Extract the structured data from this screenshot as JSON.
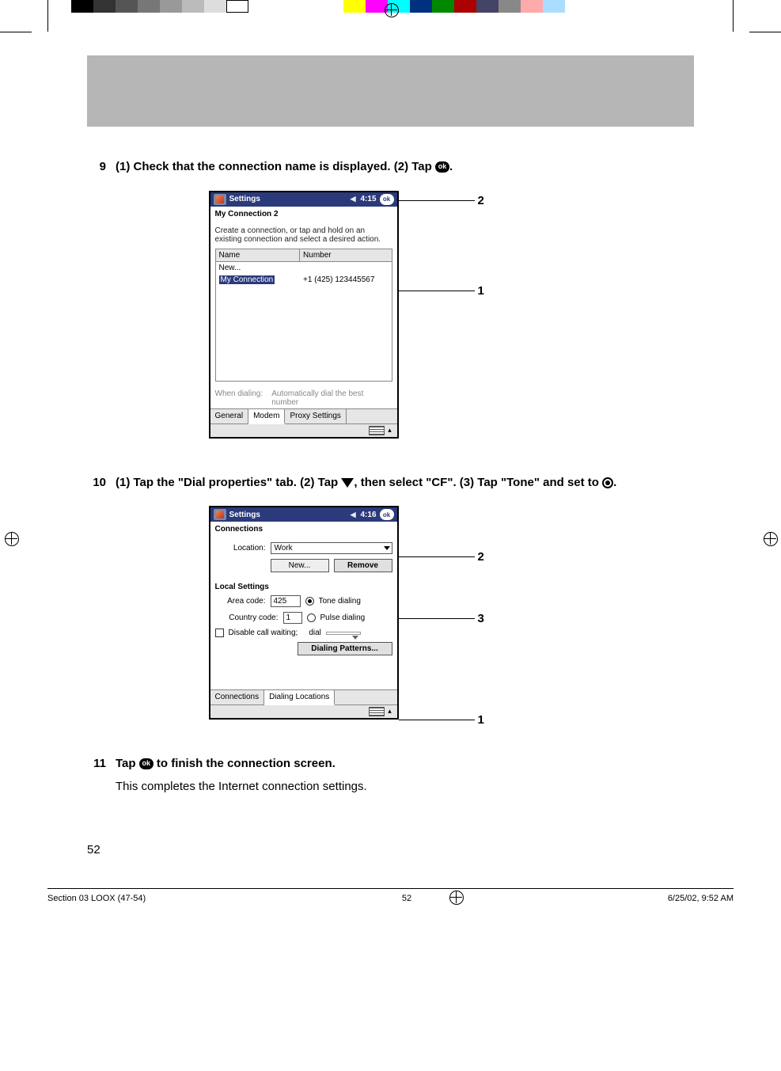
{
  "step9": {
    "num": "9",
    "text_before": "(1) Check that the connection name is displayed. (2) Tap ",
    "text_after": ".",
    "callout1": "1",
    "callout2": "2",
    "pda": {
      "title": "Settings",
      "time": "4:15",
      "ok": "ok",
      "subtitle": "My Connection 2",
      "instructions": "Create a connection, or tap and hold on an existing connection and select a desired action.",
      "col_name": "Name",
      "col_number": "Number",
      "row_new": "New...",
      "row_conn_name": "My Connection",
      "row_conn_num": "+1 (425) 123445567",
      "whendial_label": "When dialing:",
      "whendial_value": "Automatically dial the best number",
      "tab_general": "General",
      "tab_modem": "Modem",
      "tab_proxy": "Proxy Settings"
    }
  },
  "step10": {
    "num": "10",
    "text_a": "(1) Tap the \"Dial properties\" tab. (2) Tap ",
    "text_b": ", then select \"CF\". (3) Tap \"Tone\" and set to ",
    "text_c": ".",
    "callout1": "1",
    "callout2": "2",
    "callout3": "3",
    "pda": {
      "title": "Settings",
      "time": "4:16",
      "ok": "ok",
      "heading": "Connections",
      "location_label": "Location:",
      "location_value": "Work",
      "btn_new": "New...",
      "btn_remove": "Remove",
      "local_heading": "Local Settings",
      "area_label": "Area code:",
      "area_value": "425",
      "tone_label": "Tone dialing",
      "country_label": "Country code:",
      "country_value": "1",
      "pulse_label": "Pulse dialing",
      "disable_label": "Disable call waiting;",
      "dial_label": "dial",
      "patterns_btn": "Dialing Patterns...",
      "tab_connections": "Connections",
      "tab_dialing": "Dialing Locations"
    }
  },
  "step11": {
    "num": "11",
    "text_before": "Tap ",
    "text_after": " to finish the connection screen.",
    "body": "This completes the Internet connection settings."
  },
  "page_number": "52",
  "footer": {
    "left": "Section 03 LOOX (47-54)",
    "center": "52",
    "right": "6/25/02, 9:52 AM"
  },
  "ok_label": "ok",
  "color_bar": [
    "#000",
    "#333",
    "#555",
    "#777",
    "#999",
    "#bbb",
    "#ddd",
    "#fff",
    "",
    "",
    "",
    "",
    "",
    "#ff0",
    "#f0f",
    "#0ff",
    "#003",
    "#080",
    "#800",
    "#446",
    "#888",
    "#faa",
    "#adf"
  ]
}
